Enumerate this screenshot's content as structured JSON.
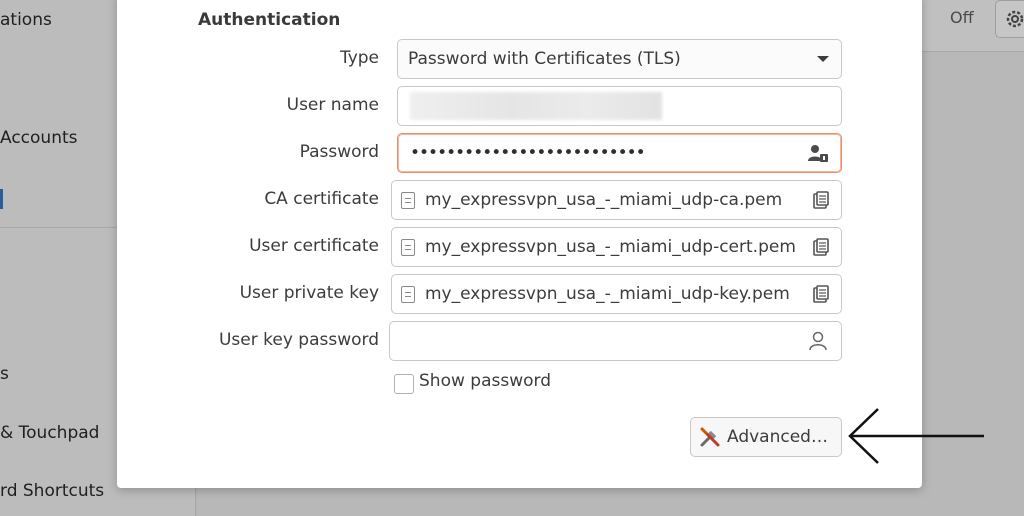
{
  "background": {
    "sidebar_items": [
      "ations",
      "Accounts",
      "s",
      "& Touchpad",
      "rd Shortcuts"
    ],
    "toggle_state": "Off"
  },
  "dialog": {
    "section_title": "Authentication",
    "type": {
      "label": "Type",
      "value": "Password with Certificates (TLS)"
    },
    "user_name": {
      "label": "User name",
      "value": ""
    },
    "password": {
      "label": "Password",
      "value": "••••••••••••••••••••••••••"
    },
    "ca_certificate": {
      "label": "CA certificate",
      "value": "my_expressvpn_usa_-_miami_udp-ca.pem"
    },
    "user_certificate": {
      "label": "User certificate",
      "value": "my_expressvpn_usa_-_miami_udp-cert.pem"
    },
    "user_private_key": {
      "label": "User private key",
      "value": "my_expressvpn_usa_-_miami_udp-key.pem"
    },
    "user_key_password": {
      "label": "User key password",
      "value": ""
    },
    "show_password_label": "Show password",
    "advanced_button": "Advanced…"
  },
  "colors": {
    "focus_border": "#e98e6b",
    "field_border": "#cdc7c2",
    "text": "#3c3c3c"
  },
  "icons": [
    "gear-icon",
    "password-user-icon",
    "file-icon",
    "clipboard-icon",
    "user-icon",
    "tools-icon",
    "annotation-arrow"
  ]
}
